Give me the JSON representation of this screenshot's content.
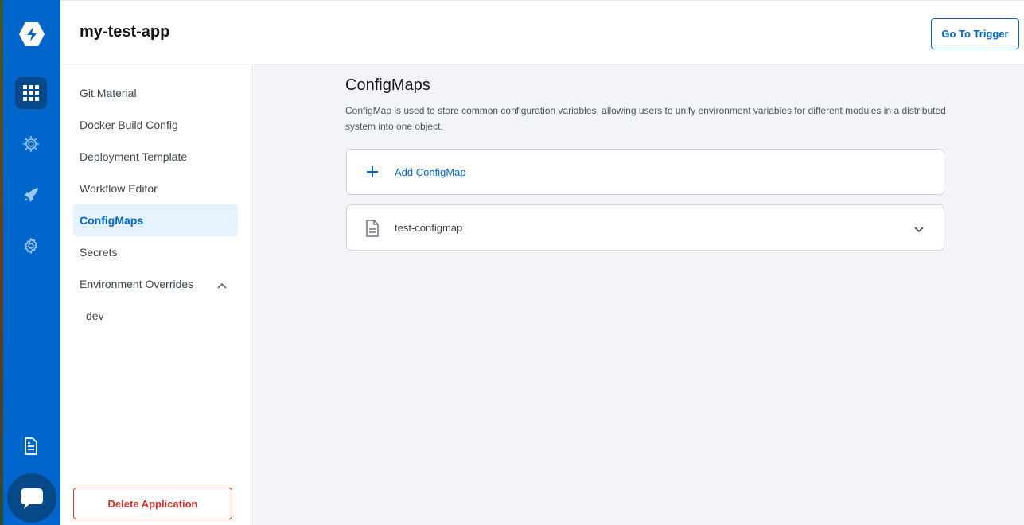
{
  "header": {
    "app_name": "my-test-app",
    "trigger_button": "Go To Trigger"
  },
  "nav": {
    "items": [
      "logo-icon",
      "apps-grid-icon",
      "security-gear-icon",
      "rocket-icon",
      "settings-gear-icon",
      "document-icon",
      "chat-icon"
    ],
    "accent": "#0066cc",
    "active_bg": "#064888"
  },
  "sidebar": {
    "items": [
      {
        "label": "Git Material"
      },
      {
        "label": "Docker Build Config"
      },
      {
        "label": "Deployment Template"
      },
      {
        "label": "Workflow Editor"
      },
      {
        "label": "ConfigMaps",
        "active": true
      },
      {
        "label": "Secrets"
      },
      {
        "label": "Environment Overrides",
        "expanded": true
      }
    ],
    "sub_items": [
      {
        "label": "dev"
      }
    ],
    "delete_button": "Delete Application"
  },
  "main": {
    "title": "ConfigMaps",
    "description": "ConfigMap is used to store common configuration variables, allowing users to unify environment variables for different modules in a distributed system into one object.",
    "add_label": "Add ConfigMap",
    "configmaps": [
      {
        "name": "test-configmap"
      }
    ]
  }
}
